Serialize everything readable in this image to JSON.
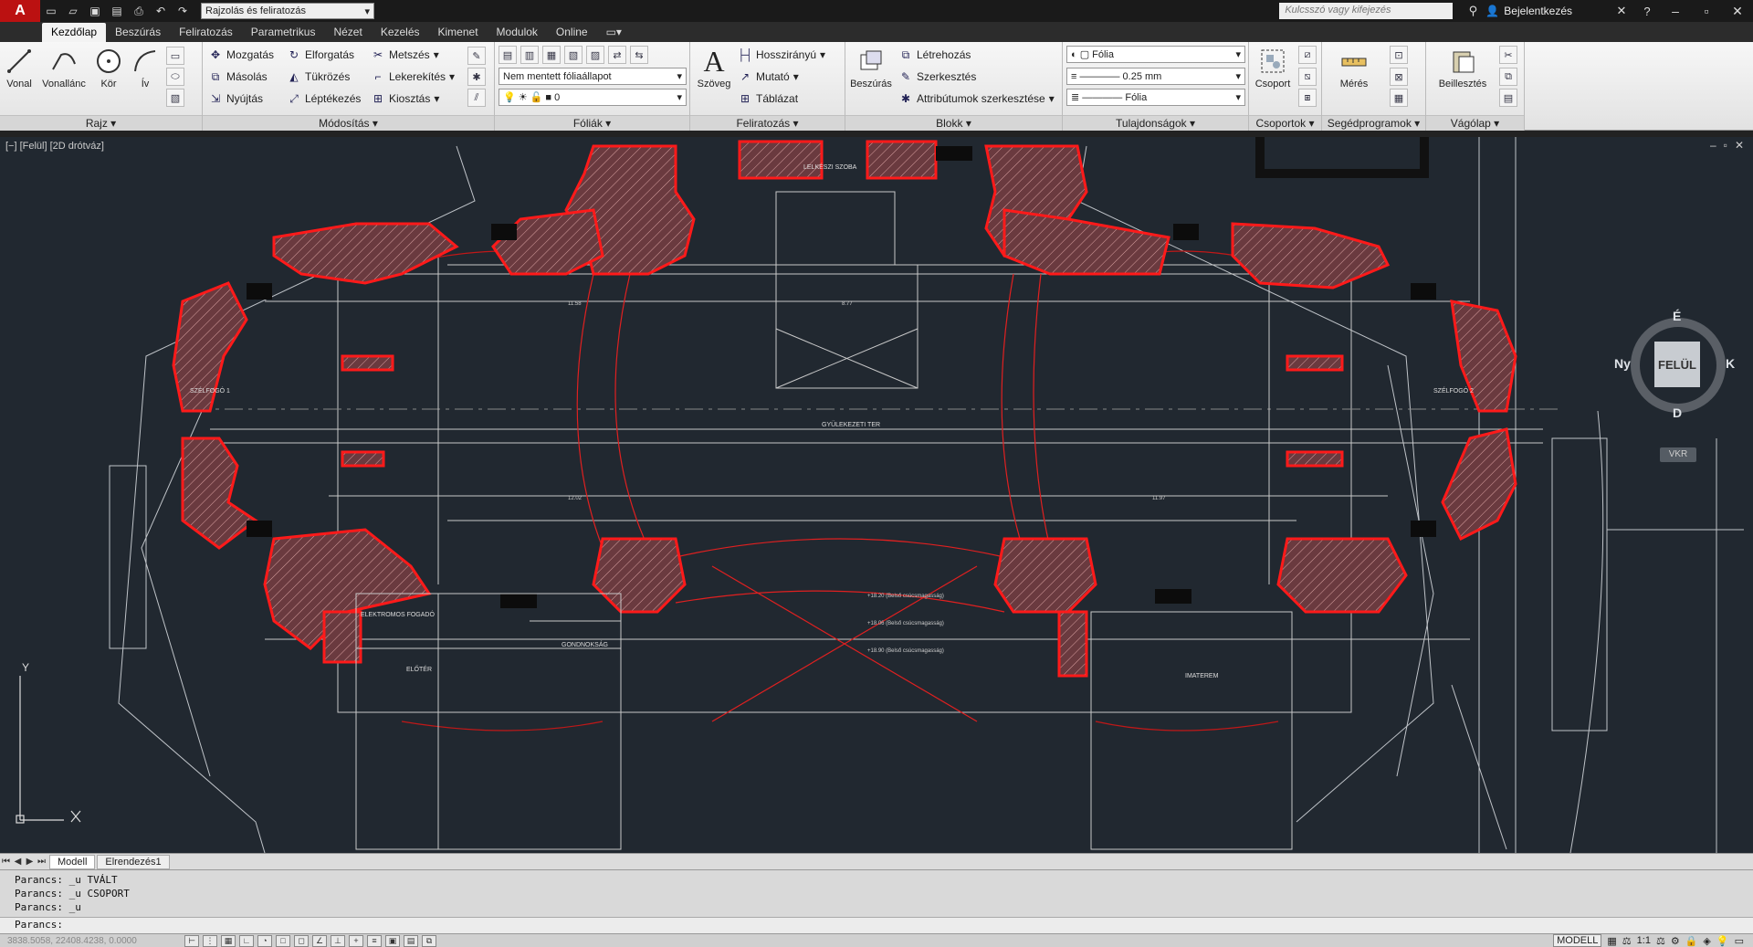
{
  "titlebar": {
    "logo": "A",
    "workspace": "Rajzolás és feliratozás",
    "search_placeholder": "Kulcsszó vagy kifejezés",
    "signin": "Bejelentkezés"
  },
  "ribbon_tabs": [
    "Kezdőlap",
    "Beszúrás",
    "Feliratozás",
    "Parametrikus",
    "Nézet",
    "Kezelés",
    "Kimenet",
    "Modulok",
    "Online"
  ],
  "ribbon": {
    "rajz": {
      "title": "Rajz",
      "vonal": "Vonal",
      "vonallanc": "Vonallánc",
      "kor": "Kör",
      "iv": "Ív"
    },
    "modositas": {
      "title": "Módosítás",
      "items": [
        "Mozgatás",
        "Elforgatás",
        "Metszés",
        "Másolás",
        "Tükrözés",
        "Lekerekítés",
        "Nyújtás",
        "Léptékezés",
        "Kiosztás"
      ]
    },
    "foliak": {
      "title": "Fóliák",
      "state": "Nem mentett fóliaállapot",
      "layer": "0"
    },
    "feliratozas": {
      "title": "Feliratozás",
      "szoveg": "Szöveg",
      "items": [
        "Hosszirányú",
        "Mutató",
        "Táblázat"
      ]
    },
    "blokk": {
      "title": "Blokk",
      "beszuras": "Beszúrás",
      "items": [
        "Létrehozás",
        "Szerkesztés",
        "Attribútumok szerkesztése"
      ]
    },
    "tulajdonsagok": {
      "title": "Tulajdonságok",
      "color": "Fólia",
      "lineweight": "0.25 mm",
      "linetype": "Fólia"
    },
    "csoportok": {
      "title": "Csoportok",
      "csoport": "Csoport"
    },
    "segedprogramok": {
      "title": "Segédprogramok",
      "meres": "Mérés"
    },
    "vagolap": {
      "title": "Vágólap",
      "beillesztes": "Beillesztés"
    }
  },
  "viewport": {
    "label": "[−] [Felül] [2D drótváz]",
    "viewcube": {
      "face": "FELÜL",
      "north": "É",
      "south": "D",
      "west": "Ny",
      "east": "K",
      "ucs": "VKR"
    }
  },
  "drawing_text": {
    "room_top": "LELKÉSZI SZOBA",
    "room_center": "GYÜLEKEZETI TER",
    "room_left": "SZÉLFOGÓ 1",
    "room_right": "SZÉLFOGÓ 2",
    "room_bl1": "ELEKTROMOS FOGADÓ",
    "room_bl2": "ELŐTÉR",
    "room_bl3": "GONDNOKSÁG",
    "room_br": "IMATEREM",
    "ann1": "+18.20 (Belső csúcsmagasság)",
    "ann2": "+18.06 (Belső csúcsmagasság)",
    "ann3": "+18.90 (Belső csúcsmagasság)",
    "dim1": "11.58",
    "dim2": "8.77",
    "dim3": "12.02",
    "dim4": "11.97"
  },
  "layout_tabs": [
    "Modell",
    "Elrendezés1"
  ],
  "command": {
    "history": [
      "Parancs:  _u TVÁLT",
      "Parancs:  _u CSOPORT",
      "Parancs:  _u"
    ],
    "prompt": "Parancs:"
  },
  "statusbar": {
    "coords": "3838.5058, 22408.4238, 0.0000",
    "mode": "MODELL",
    "scale": "1:1"
  },
  "colors": {
    "highlight": "#ff2020",
    "background": "#212830",
    "lines": "#c8c8c8"
  }
}
